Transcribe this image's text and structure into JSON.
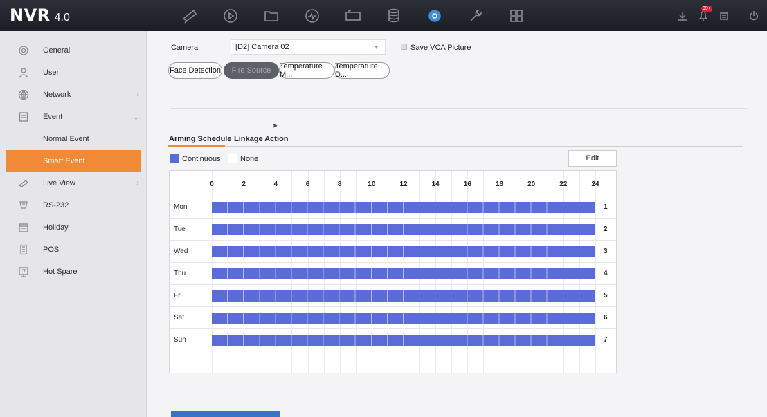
{
  "app": {
    "brand": "NVR",
    "version": "4.0"
  },
  "topnav": [
    {
      "name": "live-view-icon"
    },
    {
      "name": "playback-icon"
    },
    {
      "name": "file-manager-icon"
    },
    {
      "name": "smart-analysis-icon"
    },
    {
      "name": "storage-icon"
    },
    {
      "name": "database-icon"
    },
    {
      "name": "configuration-icon",
      "active": true
    },
    {
      "name": "maintenance-icon"
    },
    {
      "name": "system-menu-icon"
    }
  ],
  "topright": {
    "alarm_badge": "99+"
  },
  "sidebar": {
    "items": [
      {
        "label": "General"
      },
      {
        "label": "User"
      },
      {
        "label": "Network",
        "chevron": "›"
      },
      {
        "label": "Event",
        "chevron": "⌄"
      },
      {
        "label": "Live View",
        "chevron": "›"
      },
      {
        "label": "RS-232"
      },
      {
        "label": "Holiday"
      },
      {
        "label": "POS"
      },
      {
        "label": "Hot Spare"
      }
    ],
    "event_sub": [
      "Normal Event",
      "Smart Event"
    ]
  },
  "main": {
    "camera_label": "Camera",
    "camera_value": "[D2] Camera 02",
    "save_vca_label": "Save VCA Picture",
    "detection_tabs": [
      "Face Detection",
      "Fire Source",
      "Temperature M...",
      "Temperature D..."
    ],
    "active_detection_tab": "Fire Source",
    "subtabs": [
      "Arming Schedule",
      "Linkage Action"
    ],
    "legend": {
      "continuous": "Continuous",
      "none": "None",
      "continuous_color": "#5b6bd8"
    },
    "edit_label": "Edit",
    "schedule": {
      "hours": [
        "0",
        "2",
        "4",
        "6",
        "8",
        "10",
        "12",
        "14",
        "16",
        "18",
        "20",
        "22",
        "24"
      ],
      "days": [
        {
          "day": "Mon",
          "num": "1"
        },
        {
          "day": "Tue",
          "num": "2"
        },
        {
          "day": "Wed",
          "num": "3"
        },
        {
          "day": "Thu",
          "num": "4"
        },
        {
          "day": "Fri",
          "num": "5"
        },
        {
          "day": "Sat",
          "num": "6"
        },
        {
          "day": "Sun",
          "num": "7"
        }
      ]
    },
    "colors": {
      "accent_orange": "#f08a36",
      "apply_blue": "#3a72c8"
    }
  }
}
